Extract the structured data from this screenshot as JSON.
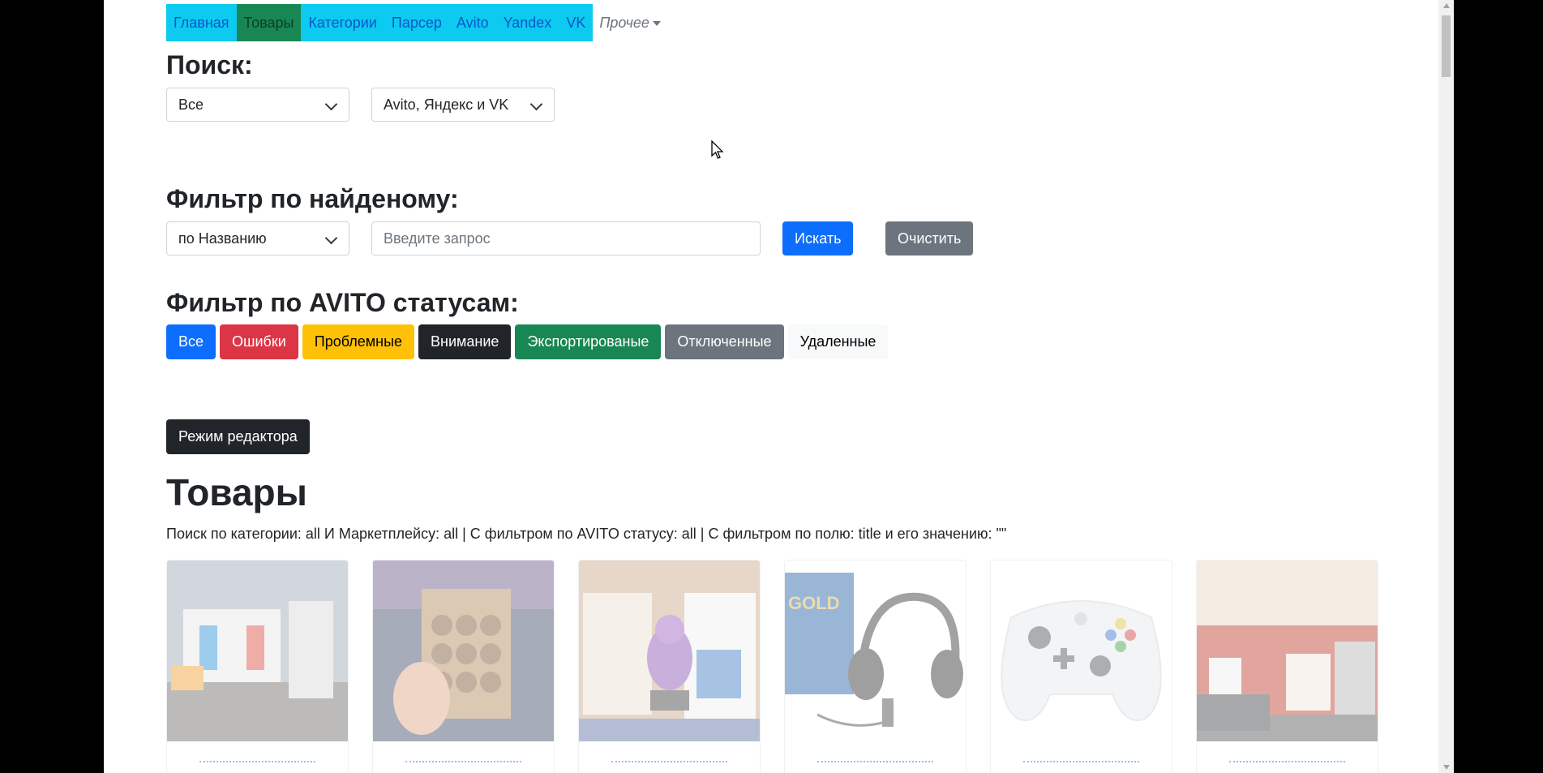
{
  "nav": {
    "items": [
      {
        "label": "Главная",
        "active": false
      },
      {
        "label": "Товары",
        "active": true
      },
      {
        "label": "Категории",
        "active": false
      },
      {
        "label": "Парсер",
        "active": false
      },
      {
        "label": "Avito",
        "active": false
      },
      {
        "label": "Yandex",
        "active": false
      },
      {
        "label": "VK",
        "active": false
      }
    ],
    "more_label": "Прочее"
  },
  "search": {
    "title": "Поиск:",
    "category_select": "Все",
    "marketplace_select": "Avito, Яндекс и VK"
  },
  "filter": {
    "title": "Фильтр по найденому:",
    "field_select": "по Названию",
    "query_placeholder": "Введите запрос",
    "query_value": "",
    "search_button": "Искать",
    "clear_button": "Очистить"
  },
  "status_filter": {
    "title": "Фильтр по AVITO статусам:",
    "buttons": [
      {
        "label": "Все",
        "color": "#0d6efd"
      },
      {
        "label": "Ошибки",
        "color": "#dc3545"
      },
      {
        "label": "Проблемные",
        "color": "#ffc107"
      },
      {
        "label": "Внимание",
        "color": "#212529"
      },
      {
        "label": "Экспортированые",
        "color": "#198754"
      },
      {
        "label": "Отключенные",
        "color": "#6c757d"
      },
      {
        "label": "Удаленные",
        "color": "#f8f9fa"
      }
    ]
  },
  "editor_button": "Режим редактора",
  "products": {
    "title": "Товары",
    "summary": "Поиск по категории: all И Маркетплейсу: all | С фильтром по AVITO статусу: all | С фильтром по полю: title и его значению: \"\"",
    "cards": [
      {
        "image": "nintendo-switch-photo-icon"
      },
      {
        "image": "coin-set-photo-icon"
      },
      {
        "image": "spyro-figure-photo-icon"
      },
      {
        "image": "ps4-headset-photo-icon"
      },
      {
        "image": "xbox-controller-photo-icon"
      },
      {
        "image": "store-building-photo-icon"
      }
    ]
  }
}
